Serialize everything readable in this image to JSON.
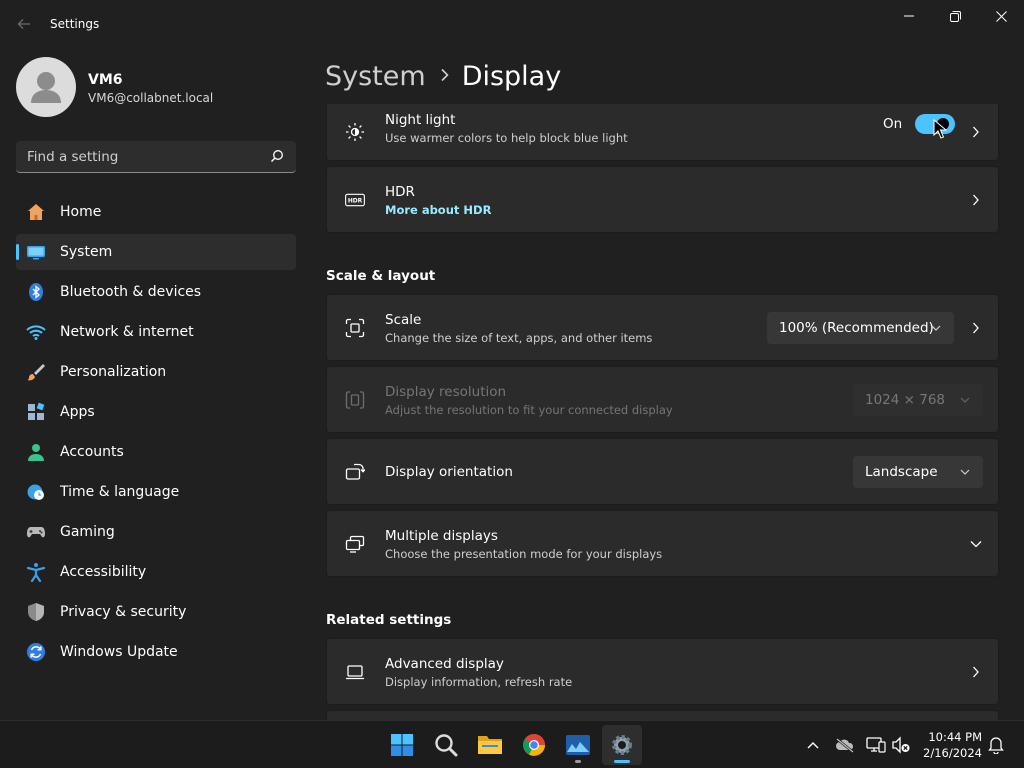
{
  "window": {
    "title": "Settings"
  },
  "profile": {
    "name": "VM6",
    "email": "VM6@collabnet.local"
  },
  "search": {
    "placeholder": "Find a setting"
  },
  "sidebar": {
    "items": [
      {
        "label": "Home",
        "icon": "home-icon"
      },
      {
        "label": "System",
        "icon": "system-icon"
      },
      {
        "label": "Bluetooth & devices",
        "icon": "bluetooth-icon"
      },
      {
        "label": "Network & internet",
        "icon": "wifi-icon"
      },
      {
        "label": "Personalization",
        "icon": "brush-icon"
      },
      {
        "label": "Apps",
        "icon": "apps-icon"
      },
      {
        "label": "Accounts",
        "icon": "accounts-icon"
      },
      {
        "label": "Time & language",
        "icon": "clock-globe-icon"
      },
      {
        "label": "Gaming",
        "icon": "gamepad-icon"
      },
      {
        "label": "Accessibility",
        "icon": "accessibility-icon"
      },
      {
        "label": "Privacy & security",
        "icon": "shield-icon"
      },
      {
        "label": "Windows Update",
        "icon": "update-icon"
      }
    ],
    "active_index": 1
  },
  "breadcrumb": {
    "parent": "System",
    "current": "Display"
  },
  "night_light": {
    "title": "Night light",
    "desc": "Use warmer colors to help block blue light",
    "state": "On"
  },
  "hdr": {
    "title": "HDR",
    "link": "More about HDR"
  },
  "scale_layout": {
    "heading": "Scale & layout",
    "scale": {
      "title": "Scale",
      "desc": "Change the size of text, apps, and other items",
      "value": "100% (Recommended)"
    },
    "resolution": {
      "title": "Display resolution",
      "desc": "Adjust the resolution to fit your connected display",
      "value": "1024 × 768"
    },
    "orientation": {
      "title": "Display orientation",
      "value": "Landscape"
    },
    "multiple": {
      "title": "Multiple displays",
      "desc": "Choose the presentation mode for your displays"
    }
  },
  "related": {
    "heading": "Related settings",
    "advanced": {
      "title": "Advanced display",
      "desc": "Display information, refresh rate"
    }
  },
  "taskbar": {
    "time": "10:44 PM",
    "date": "2/16/2024"
  },
  "colors": {
    "accent": "#4cc2ff",
    "background": "#202020",
    "card": "#2b2b2b",
    "link": "#99ebff"
  }
}
